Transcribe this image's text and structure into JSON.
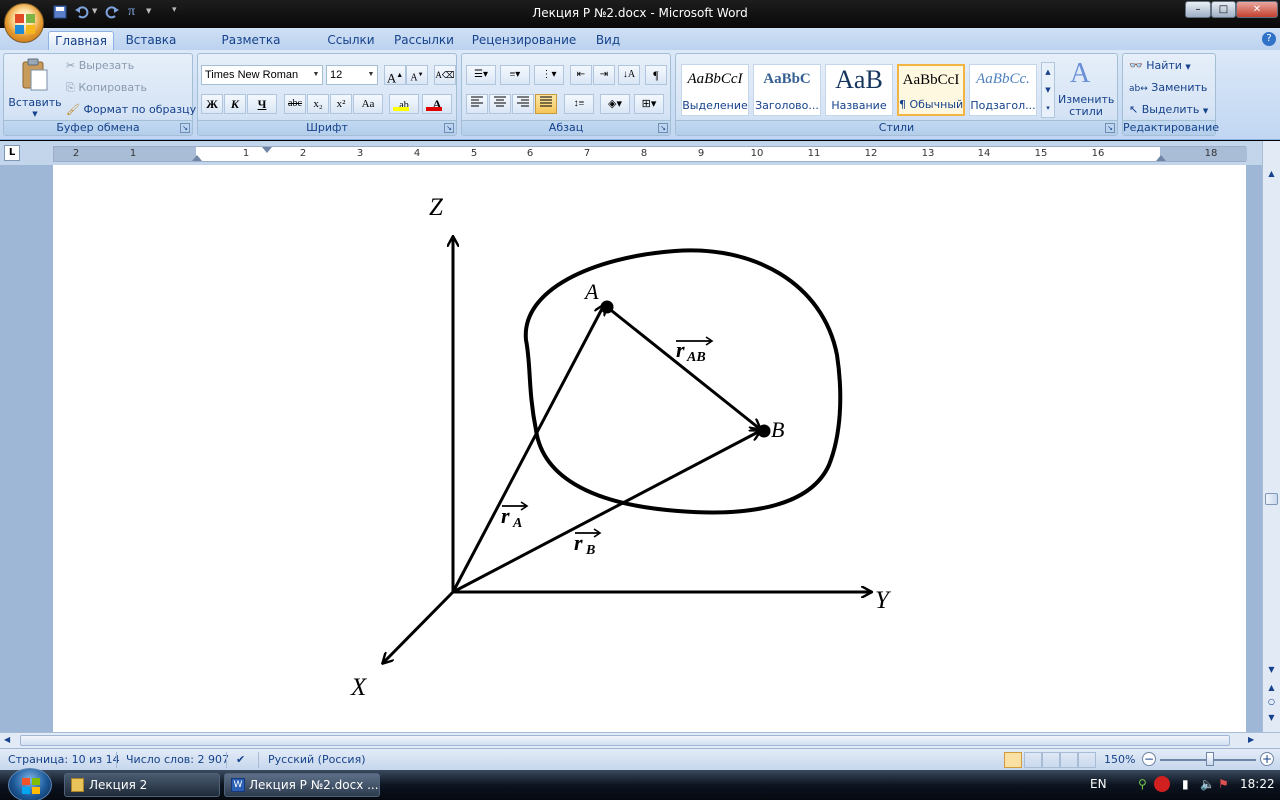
{
  "window": {
    "title": "Лекция Р №2.docx - Microsoft Word",
    "minimize": "–",
    "maximize": "□",
    "close": "✕"
  },
  "tabs": [
    {
      "label": "Главная",
      "active": true
    },
    {
      "label": "Вставка"
    },
    {
      "label": "Разметка страницы"
    },
    {
      "label": "Ссылки"
    },
    {
      "label": "Рассылки"
    },
    {
      "label": "Рецензирование"
    },
    {
      "label": "Вид"
    }
  ],
  "ribbon": {
    "clipboard": {
      "label": "Буфер обмена",
      "paste": "Вставить",
      "cut": "Вырезать",
      "copy": "Копировать",
      "format_painter": "Формат по образцу"
    },
    "font": {
      "label": "Шрифт",
      "family": "Times New Roman",
      "size": "12",
      "bold": "Ж",
      "italic": "К",
      "underline": "Ч",
      "strike": "abc",
      "subscript": "x₂",
      "superscript": "x²",
      "change_case": "Aa",
      "grow": "A",
      "shrink": "A",
      "highlight_color": "#ffff00",
      "font_color": "#e00000"
    },
    "paragraph": {
      "label": "Абзац"
    },
    "styles": {
      "label": "Стили",
      "items": [
        {
          "sample": "AaBbCcI",
          "name": "Выделение"
        },
        {
          "sample": "AaBbC",
          "name": "Заголово..."
        },
        {
          "sample": "AaB",
          "name": "Название"
        },
        {
          "sample": "AaBbCcI",
          "name": "¶ Обычный",
          "selected": true
        },
        {
          "sample": "AaBbCc.",
          "name": "Подзагол..."
        }
      ],
      "change_styles": "Изменить стили"
    },
    "editing": {
      "label": "Редактирование",
      "find": "Найти",
      "replace": "Заменить",
      "select": "Выделить"
    }
  },
  "ruler": {
    "numbers": [
      "2",
      "1",
      "1",
      "2",
      "3",
      "4",
      "5",
      "6",
      "7",
      "8",
      "9",
      "10",
      "11",
      "12",
      "13",
      "14",
      "15",
      "16",
      "18"
    ],
    "tab_selector": "L"
  },
  "figure": {
    "axis_z": "Z",
    "axis_y": "Y",
    "axis_x": "X",
    "point_a": "A",
    "point_b": "B",
    "vec_ab_main": "r",
    "vec_ab_sub": "AB",
    "vec_a_main": "r",
    "vec_a_sub": "A",
    "vec_b_main": "r",
    "vec_b_sub": "B"
  },
  "status": {
    "page": "Страница: 10 из 14",
    "words": "Число слов: 2 907",
    "language": "Русский (Россия)",
    "zoom": "150%",
    "zoom_out": "−",
    "zoom_in": "+"
  },
  "taskbar": {
    "items": [
      {
        "label": "Лекция 2"
      },
      {
        "label": "Лекция Р №2.docx ..."
      }
    ],
    "lang": "EN",
    "time": "18:22"
  }
}
